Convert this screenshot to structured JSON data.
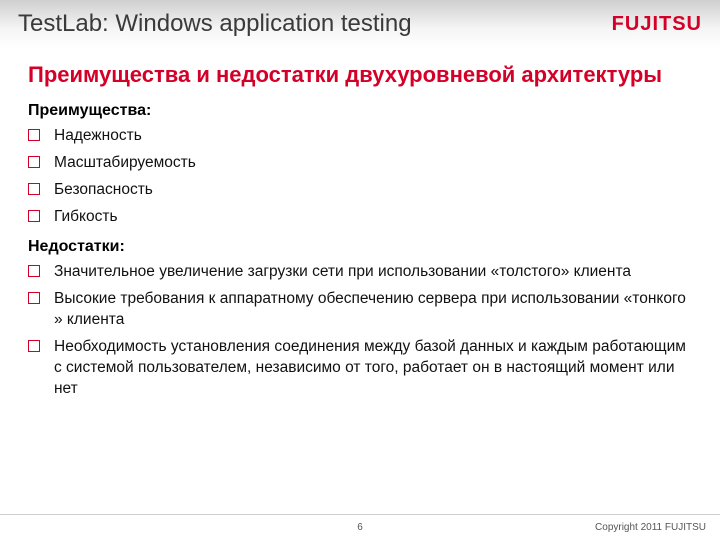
{
  "header": {
    "title": "TestLab: Windows application testing",
    "logo_text": "FUJITSU"
  },
  "subtitle": "Преимущества и недостатки двухуровневой архитектуры",
  "sections": [
    {
      "heading": "Преимущества:",
      "items": [
        "Надежность",
        "Масштабируемость",
        "Безопасность",
        "Гибкость"
      ]
    },
    {
      "heading": "Недостатки:",
      "items": [
        "Значительное увеличение загрузки сети при использовании «толстого» клиента",
        "Высокие требования к аппаратному обеспечению сервера при использовании «тонкого » клиента",
        "Необходимость установления соединения между базой данных и каждым работающим с системой пользователем, независимо от того, работает он в настоящий момент или нет"
      ]
    }
  ],
  "footer": {
    "page": "6",
    "copyright": "Copyright 2011 FUJITSU"
  }
}
